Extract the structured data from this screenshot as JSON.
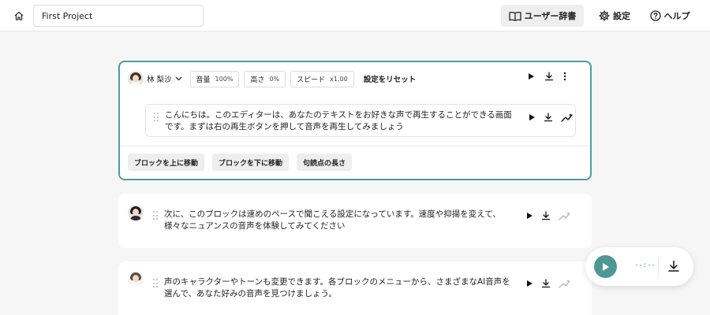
{
  "header": {
    "project_title": "First Project",
    "dictionary_label": "ユーザー辞書",
    "settings_label": "設定",
    "help_label": "ヘルプ"
  },
  "active_block": {
    "voice_name": "林 梨沙",
    "volume_label": "音量",
    "volume_value": "100%",
    "pitch_label": "高さ",
    "pitch_value": "0%",
    "speed_label": "スピード",
    "speed_value": "x1.00",
    "reset_label": "設定をリセット",
    "line1": "こんにちは。このエディターは、あなたのテキストをお好きな声で再生することができる画面",
    "line2": "です。まずは右の再生ボタンを押して音声を再生してみましょう",
    "move_up_label": "ブロックを上に移動",
    "move_down_label": "ブロックを下に移動",
    "pause_length_label": "句読点の長さ"
  },
  "blocks": [
    {
      "line1": "次に、このブロックは速めのペースで聞こえる設定になっています。速度や抑揚を変えて、",
      "line2": "様々なニュアンスの音声を体験してみてください"
    },
    {
      "line1": "声のキャラクターやトーンも変更できます。各ブロックのメニューから、さまざまなAI音声を",
      "line2": "選んで、あなた好みの音声を見つけましょう。"
    }
  ],
  "player": {
    "time": "--:--"
  },
  "colors": {
    "accent": "#4a9e9a",
    "player_accent": "#4e9893",
    "background": "#f6f6f7"
  },
  "icons": [
    "home-icon",
    "book-icon",
    "gear-icon",
    "help-icon",
    "play-icon",
    "download-icon",
    "more-icon",
    "sparkle-wand-icon",
    "drag-handle-icon",
    "chevron-down-icon"
  ]
}
